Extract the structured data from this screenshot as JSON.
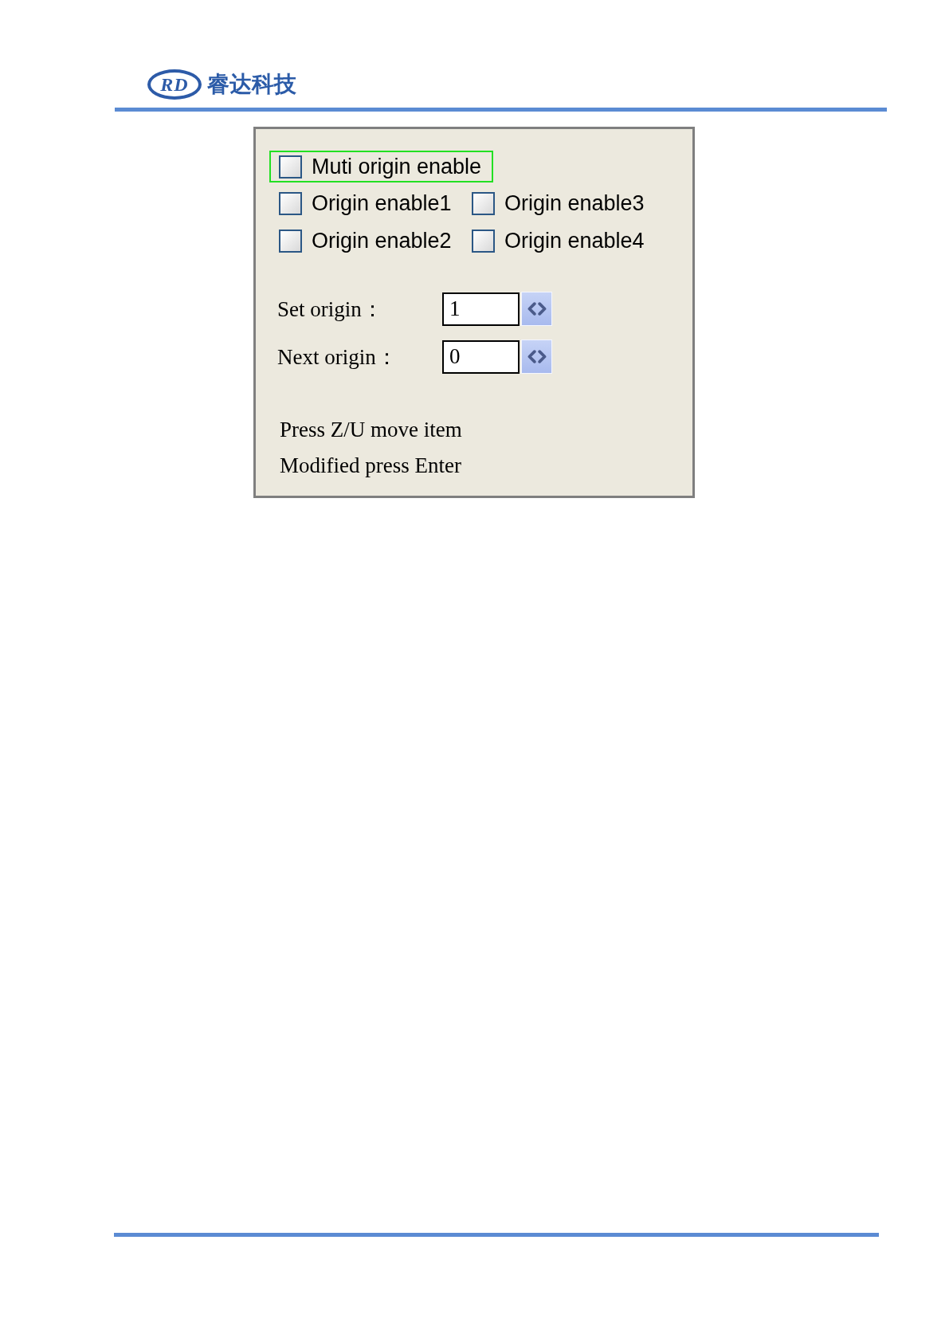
{
  "header": {
    "logo_mark": "RD",
    "company_name": "睿达科技"
  },
  "dialog": {
    "multi_origin": {
      "label": "Muti origin enable",
      "checked": false,
      "focused": true
    },
    "origin_enables": [
      {
        "label": "Origin enable1",
        "checked": false,
        "focused": false
      },
      {
        "label": "Origin enable3",
        "checked": false,
        "focused": false
      },
      {
        "label": "Origin enable2",
        "checked": false,
        "focused": false
      },
      {
        "label": "Origin enable4",
        "checked": false,
        "focused": false
      }
    ],
    "fields": [
      {
        "label": "Set origin：",
        "value": "1"
      },
      {
        "label": "Next origin：",
        "value": "0"
      }
    ],
    "hints": [
      "Press Z/U move item",
      "Modified press Enter"
    ]
  }
}
